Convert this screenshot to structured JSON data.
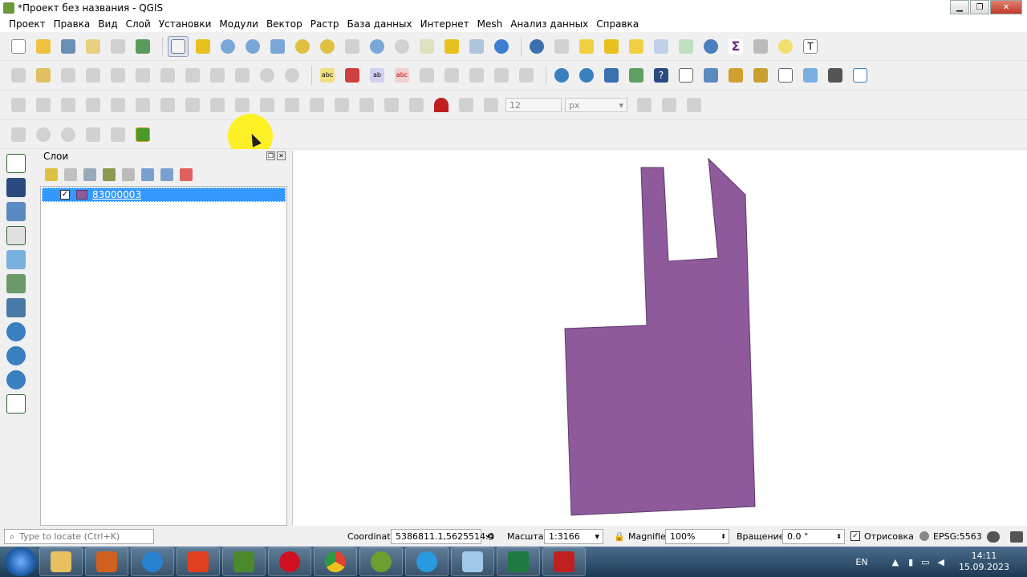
{
  "window": {
    "title": "*Проект без названия - QGIS"
  },
  "menu": [
    "Проект",
    "Правка",
    "Вид",
    "Слой",
    "Установки",
    "Модули",
    "Вектор",
    "Растр",
    "База данных",
    "Интернет",
    "Mesh",
    "Анализ данных",
    "Справка"
  ],
  "snapping": {
    "tolerance": "12",
    "unit": "px"
  },
  "layers_panel": {
    "title": "Слои",
    "layers": [
      {
        "name": "83000003",
        "checked": true,
        "color": "#8e5a9c"
      }
    ]
  },
  "map": {
    "feature_fill": "#8e5a9c",
    "feature_stroke": "#5e3a6a"
  },
  "statusbar": {
    "locate_placeholder": "Type to locate (Ctrl+K)",
    "coordinate_label": "Coordinate",
    "coordinate_value": "5386811.1,5625514.4",
    "scale_label": "Масштаб",
    "scale_value": "1:3166",
    "magnifier_label": "Magnifier",
    "magnifier_value": "100%",
    "rotation_label": "Вращение",
    "rotation_value": "0.0 °",
    "render_label": "Отрисовка",
    "crs": "EPSG:5563"
  },
  "taskbar": {
    "lang": "EN",
    "time": "14:11",
    "date": "15.09.2023",
    "apps": [
      "file-explorer",
      "media-player",
      "internet-explorer",
      "acrobat",
      "qgis-image",
      "opera",
      "chrome",
      "qgis",
      "telegram",
      "notepad",
      "excel",
      "autocad"
    ]
  }
}
